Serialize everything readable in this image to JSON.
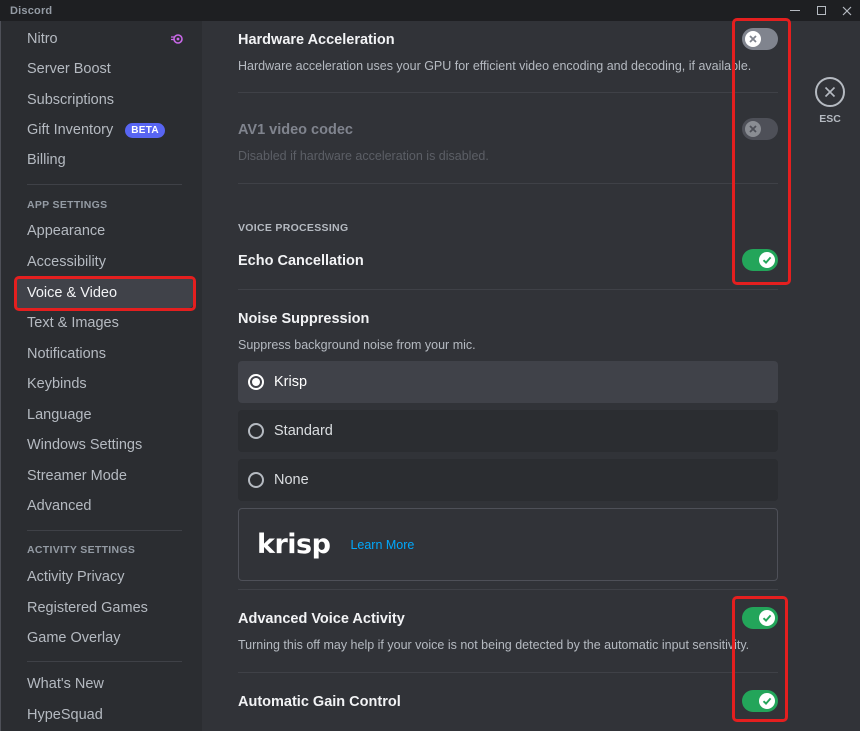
{
  "window": {
    "brand": "Discord"
  },
  "sidebar": {
    "items_top": [
      {
        "label": "Nitro",
        "icon": "nitro-icon"
      },
      {
        "label": "Server Boost"
      },
      {
        "label": "Subscriptions"
      },
      {
        "label": "Gift Inventory",
        "badge": "BETA"
      },
      {
        "label": "Billing"
      }
    ],
    "app_settings_header": "APP SETTINGS",
    "app_settings": [
      {
        "label": "Appearance"
      },
      {
        "label": "Accessibility"
      },
      {
        "label": "Voice & Video",
        "selected": true
      },
      {
        "label": "Text & Images"
      },
      {
        "label": "Notifications"
      },
      {
        "label": "Keybinds"
      },
      {
        "label": "Language"
      },
      {
        "label": "Windows Settings"
      },
      {
        "label": "Streamer Mode"
      },
      {
        "label": "Advanced"
      }
    ],
    "activity_settings_header": "ACTIVITY SETTINGS",
    "activity_settings": [
      {
        "label": "Activity Privacy"
      },
      {
        "label": "Registered Games"
      },
      {
        "label": "Game Overlay"
      }
    ],
    "items_bottom": [
      {
        "label": "What's New"
      },
      {
        "label": "HypeSquad"
      }
    ]
  },
  "settings": {
    "hardware_acceleration": {
      "title": "Hardware Acceleration",
      "desc": "Hardware acceleration uses your GPU for efficient video encoding and decoding, if available.",
      "state": "off"
    },
    "av1": {
      "title": "AV1 video codec",
      "desc": "Disabled if hardware acceleration is disabled.",
      "state": "disabled"
    },
    "voice_processing_header": "VOICE PROCESSING",
    "echo_cancellation": {
      "title": "Echo Cancellation",
      "state": "on"
    },
    "noise_suppression": {
      "title": "Noise Suppression",
      "desc": "Suppress background noise from your mic.",
      "options": [
        "Krisp",
        "Standard",
        "None"
      ],
      "selected": "Krisp"
    },
    "krisp": {
      "logo": "krisp",
      "link": "Learn More"
    },
    "advanced_voice_activity": {
      "title": "Advanced Voice Activity",
      "desc": "Turning this off may help if your voice is not being detected by the automatic input sensitivity.",
      "state": "on"
    },
    "automatic_gain_control": {
      "title": "Automatic Gain Control",
      "state": "on"
    }
  },
  "esc": {
    "label": "ESC"
  },
  "colors": {
    "toggle_on": "#23a55a",
    "highlight": "#e41f1f",
    "link": "#00a8fc",
    "badge": "#5865f2"
  }
}
